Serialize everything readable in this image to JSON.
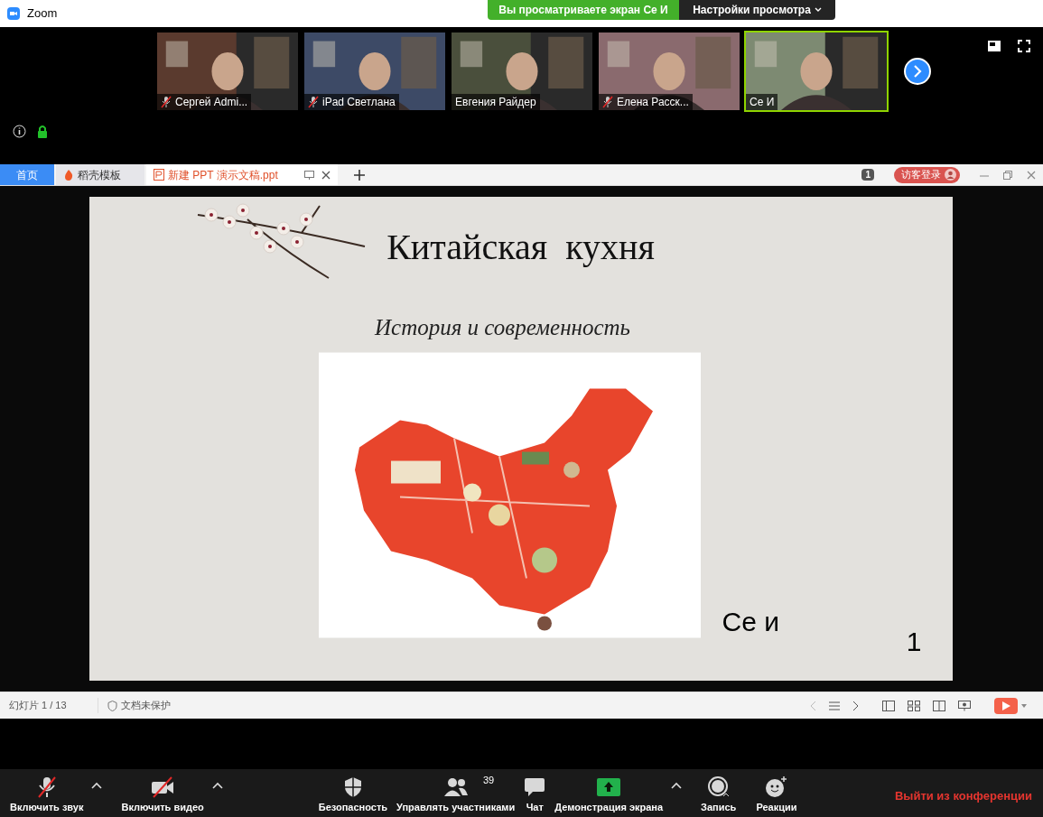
{
  "window": {
    "title": "Zoom"
  },
  "share_banner": {
    "text": "Вы просматриваете экран Се И",
    "settings": "Настройки просмотра"
  },
  "participants": [
    {
      "name": "Сергей Admi...",
      "muted": true,
      "speaking": false
    },
    {
      "name": "iPad Светлана",
      "muted": true,
      "speaking": false
    },
    {
      "name": "Евгения Райдер",
      "muted": false,
      "speaking": false
    },
    {
      "name": "Елена Расск...",
      "muted": true,
      "speaking": false
    },
    {
      "name": "Се И",
      "muted": false,
      "speaking": true
    }
  ],
  "app_tabs": [
    {
      "label": "首页",
      "selected": true,
      "kind": "home"
    },
    {
      "label": "稻壳模板",
      "selected": false,
      "kind": "template"
    },
    {
      "label": "新建 PPT 演示文稿.ppt",
      "selected": false,
      "kind": "document"
    }
  ],
  "app_bar": {
    "window_count": "1",
    "login": "访客登录"
  },
  "slide": {
    "title": "Китайская  кухня",
    "subtitle": "История и современность",
    "author": "Се и",
    "number": "1"
  },
  "status_bar": {
    "slide_counter": "幻灯片 1 / 13",
    "protection": "文档未保护"
  },
  "toolbar": [
    {
      "label": "Включить звук",
      "off": true,
      "has_menu": true
    },
    {
      "label": "Включить видео",
      "off": true,
      "has_menu": true
    },
    {
      "label": "Безопасность"
    },
    {
      "label": "Управлять участниками",
      "badge": "39"
    },
    {
      "label": "Чат"
    },
    {
      "label": "Демонстрация экрана",
      "has_menu": true
    },
    {
      "label": "Запись"
    },
    {
      "label": "Реакции"
    }
  ],
  "leave_button": "Выйти из конференции"
}
